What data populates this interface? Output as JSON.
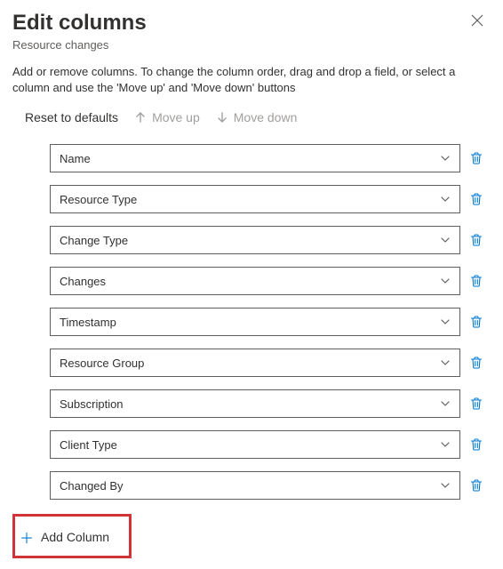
{
  "title": "Edit columns",
  "subtitle": "Resource changes",
  "description": "Add or remove columns. To change the column order, drag and drop a field, or select a column and use the 'Move up' and 'Move down' buttons",
  "toolbar": {
    "reset": "Reset to defaults",
    "move_up": "Move up",
    "move_down": "Move down"
  },
  "columns": [
    {
      "label": "Name"
    },
    {
      "label": "Resource Type"
    },
    {
      "label": "Change Type"
    },
    {
      "label": "Changes"
    },
    {
      "label": "Timestamp"
    },
    {
      "label": "Resource Group"
    },
    {
      "label": "Subscription"
    },
    {
      "label": "Client Type"
    },
    {
      "label": "Changed By"
    }
  ],
  "add_column": "Add Column",
  "icons": {
    "accent": "#0078d4",
    "muted": "#a19f9d"
  }
}
